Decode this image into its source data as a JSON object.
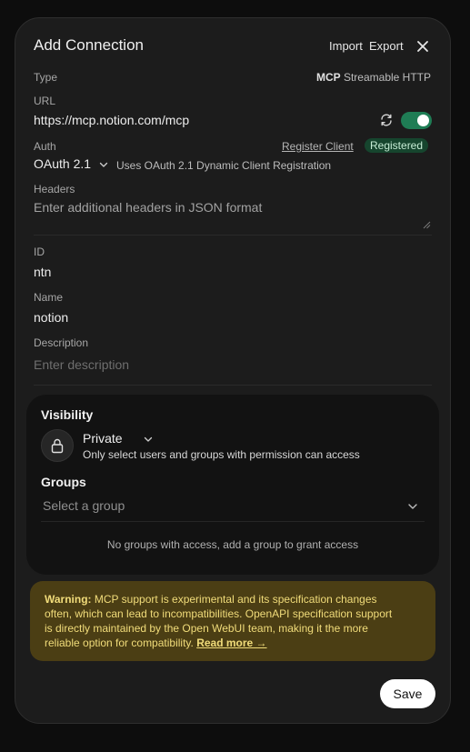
{
  "modal": {
    "title": "Add Connection",
    "import_label": "Import",
    "export_label": "Export"
  },
  "type": {
    "label": "Type",
    "value_prefix": "MCP",
    "value_suffix": "Streamable HTTP"
  },
  "url": {
    "label": "URL",
    "value": "https://mcp.notion.com/mcp",
    "enabled": true
  },
  "auth": {
    "label": "Auth",
    "register_client": "Register Client",
    "status_badge": "Registered",
    "method": "OAuth 2.1",
    "description": "Uses OAuth 2.1 Dynamic Client Registration"
  },
  "headers": {
    "label": "Headers",
    "placeholder": "Enter additional headers in JSON format"
  },
  "id": {
    "label": "ID",
    "value": "ntn"
  },
  "name": {
    "label": "Name",
    "value": "notion"
  },
  "description": {
    "label": "Description",
    "placeholder": "Enter description"
  },
  "visibility": {
    "title": "Visibility",
    "value": "Private",
    "description": "Only select users and groups with permission can access",
    "icon": "lock-icon"
  },
  "groups": {
    "title": "Groups",
    "placeholder": "Select a group",
    "empty_text": "No groups with access, add a group to grant access"
  },
  "warning": {
    "prefix": "Warning:",
    "line1": "MCP support is experimental and its specification changes",
    "line2": "often, which can lead to incompatibilities. OpenAPI specification support",
    "line3": "is directly maintained by the Open WebUI team, making it the more",
    "line4": "reliable option for compatibility.",
    "read_more": "Read more →"
  },
  "save_label": "Save",
  "colors": {
    "toggle_on": "#1f7d55",
    "badge_bg": "#16452e",
    "warning_bg": "#4b3e14",
    "warning_text": "#f1dc7a"
  }
}
